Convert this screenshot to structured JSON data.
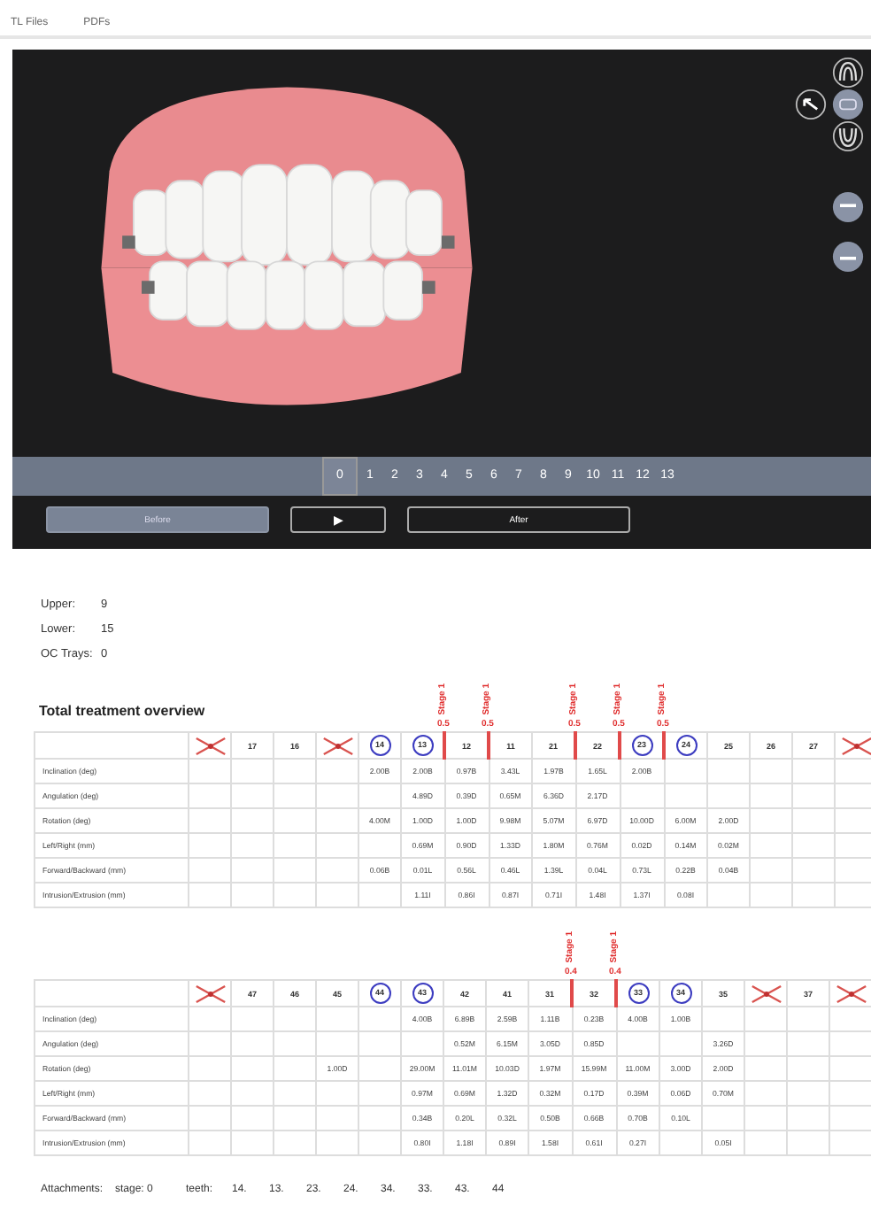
{
  "tabs": [
    {
      "label": "TL Files"
    },
    {
      "label": "PDFs"
    }
  ],
  "viewer": {
    "frames": [
      {
        "label": "0",
        "selected": true
      },
      {
        "label": "1",
        "selected": false
      },
      {
        "label": "2",
        "selected": false
      },
      {
        "label": "3",
        "selected": false
      },
      {
        "label": "4",
        "selected": false
      },
      {
        "label": "5",
        "selected": false
      },
      {
        "label": "6",
        "selected": false
      },
      {
        "label": "7",
        "selected": false
      },
      {
        "label": "8",
        "selected": false
      },
      {
        "label": "9",
        "selected": false
      },
      {
        "label": "10",
        "selected": false
      },
      {
        "label": "11",
        "selected": false
      },
      {
        "label": "12",
        "selected": false
      },
      {
        "label": "13",
        "selected": false
      }
    ],
    "buttons": [
      {
        "kind": "text",
        "label": "Before",
        "selected": true
      },
      {
        "kind": "play",
        "label": "▶",
        "selected": false
      },
      {
        "kind": "text",
        "label": "After",
        "selected": false
      }
    ]
  },
  "counts": [
    {
      "label": "Upper:",
      "value": "9"
    },
    {
      "label": "Lower:",
      "value": "15"
    },
    {
      "label": "OC Trays:",
      "value": "0"
    }
  ],
  "overview_title": "Total treatment overview",
  "tables": [
    {
      "columns": [
        {
          "kind": "missing"
        },
        {
          "kind": "plain",
          "label": "17"
        },
        {
          "kind": "plain",
          "label": "16"
        },
        {
          "kind": "missing"
        },
        {
          "kind": "circled",
          "label": "14"
        },
        {
          "kind": "circled",
          "label": "13"
        },
        {
          "kind": "plain",
          "label": "12",
          "stage": {
            "label": "Stage 1",
            "value": "0.5"
          }
        },
        {
          "kind": "plain",
          "label": "11",
          "stage": {
            "label": "Stage 1",
            "value": "0.5"
          }
        },
        {
          "kind": "plain",
          "label": "21"
        },
        {
          "kind": "plain",
          "label": "22",
          "stage": {
            "label": "Stage 1",
            "value": "0.5"
          }
        },
        {
          "kind": "circled",
          "label": "23",
          "stage": {
            "label": "Stage 1",
            "value": "0.5"
          }
        },
        {
          "kind": "circled",
          "label": "24",
          "stage": {
            "label": "Stage 1",
            "value": "0.5"
          }
        },
        {
          "kind": "plain",
          "label": "25"
        },
        {
          "kind": "plain",
          "label": "26"
        },
        {
          "kind": "plain",
          "label": "27"
        },
        {
          "kind": "missing"
        }
      ],
      "rows": [
        {
          "label": "Inclination (deg)",
          "cells": [
            null,
            null,
            null,
            null,
            "2.00B",
            "2.00B",
            "0.97B",
            "3.43L",
            "1.97B",
            "1.65L",
            "2.00B",
            null,
            null,
            null,
            null,
            null
          ]
        },
        {
          "label": "Angulation (deg)",
          "cells": [
            null,
            null,
            null,
            null,
            null,
            "4.89D",
            "0.39D",
            "0.65M",
            "6.36D",
            "2.17D",
            null,
            null,
            null,
            null,
            null,
            null
          ]
        },
        {
          "label": "Rotation (deg)",
          "cells": [
            null,
            null,
            null,
            null,
            "4.00M",
            "1.00D",
            "1.00D",
            "9.98M",
            "5.07M",
            "6.97D",
            "10.00D",
            "6.00M",
            "2.00D",
            null,
            null,
            null
          ]
        },
        {
          "label": "Left/Right (mm)",
          "cells": [
            null,
            null,
            null,
            null,
            null,
            "0.69M",
            "0.90D",
            "1.33D",
            "1.80M",
            "0.76M",
            "0.02D",
            "0.14M",
            "0.02M",
            null,
            null,
            null
          ]
        },
        {
          "label": "Forward/Backward (mm)",
          "cells": [
            null,
            null,
            null,
            null,
            "0.06B",
            "0.01L",
            "0.56L",
            "0.46L",
            "1.39L",
            "0.04L",
            "0.73L",
            "0.22B",
            "0.04B",
            null,
            null,
            null
          ]
        },
        {
          "label": "Intrusion/Extrusion (mm)",
          "cells": [
            null,
            null,
            null,
            null,
            null,
            "1.11I",
            "0.86I",
            "0.87I",
            "0.71I",
            "1.48I",
            "1.37I",
            "0.08I",
            null,
            null,
            null,
            null
          ]
        }
      ]
    },
    {
      "columns": [
        {
          "kind": "missing"
        },
        {
          "kind": "plain",
          "label": "47"
        },
        {
          "kind": "plain",
          "label": "46"
        },
        {
          "kind": "plain",
          "label": "45"
        },
        {
          "kind": "circled",
          "label": "44"
        },
        {
          "kind": "circled",
          "label": "43"
        },
        {
          "kind": "plain",
          "label": "42"
        },
        {
          "kind": "plain",
          "label": "41"
        },
        {
          "kind": "plain",
          "label": "31"
        },
        {
          "kind": "plain",
          "label": "32",
          "stage": {
            "label": "Stage 1",
            "value": "0.4"
          }
        },
        {
          "kind": "circled",
          "label": "33",
          "stage": {
            "label": "Stage 1",
            "value": "0.4"
          }
        },
        {
          "kind": "circled",
          "label": "34"
        },
        {
          "kind": "plain",
          "label": "35"
        },
        {
          "kind": "missing"
        },
        {
          "kind": "plain",
          "label": "37"
        },
        {
          "kind": "missing"
        }
      ],
      "rows": [
        {
          "label": "Inclination (deg)",
          "cells": [
            null,
            null,
            null,
            null,
            null,
            "4.00B",
            "6.89B",
            "2.59B",
            "1.11B",
            "0.23B",
            "4.00B",
            "1.00B",
            null,
            null,
            null,
            null
          ]
        },
        {
          "label": "Angulation (deg)",
          "cells": [
            null,
            null,
            null,
            null,
            null,
            null,
            "0.52M",
            "6.15M",
            "3.05D",
            "0.85D",
            null,
            null,
            "3.26D",
            null,
            null,
            null
          ]
        },
        {
          "label": "Rotation (deg)",
          "cells": [
            null,
            null,
            null,
            "1.00D",
            null,
            "29.00M",
            "11.01M",
            "10.03D",
            "1.97M",
            "15.99M",
            "11.00M",
            "3.00D",
            "2.00D",
            null,
            null,
            null
          ]
        },
        {
          "label": "Left/Right (mm)",
          "cells": [
            null,
            null,
            null,
            null,
            null,
            "0.97M",
            "0.69M",
            "1.32D",
            "0.32M",
            "0.17D",
            "0.39M",
            "0.06D",
            "0.70M",
            null,
            null,
            null
          ]
        },
        {
          "label": "Forward/Backward (mm)",
          "cells": [
            null,
            null,
            null,
            null,
            null,
            "0.34B",
            "0.20L",
            "0.32L",
            "0.50B",
            "0.66B",
            "0.70B",
            "0.10L",
            null,
            null,
            null,
            null
          ]
        },
        {
          "label": "Intrusion/Extrusion (mm)",
          "cells": [
            null,
            null,
            null,
            null,
            null,
            "0.80I",
            "1.18I",
            "0.89I",
            "1.58I",
            "0.61I",
            "0.27I",
            null,
            "0.05I",
            null,
            null,
            null
          ]
        }
      ]
    }
  ],
  "attachments": {
    "label": "Attachments:",
    "stage": "stage: 0",
    "teeth_label": "teeth:",
    "teeth": [
      "14.",
      "13.",
      "23.",
      "24.",
      "34.",
      "33.",
      "43.",
      "44"
    ]
  }
}
